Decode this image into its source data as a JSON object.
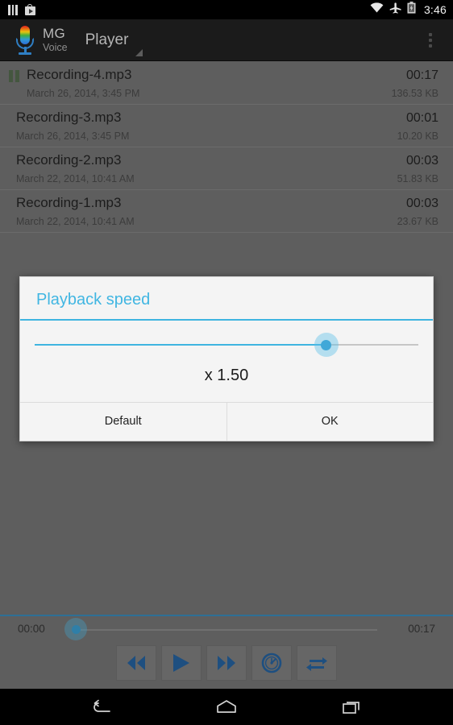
{
  "statusbar": {
    "icons": [
      "bars-icon",
      "play-store-icon",
      "wifi-icon",
      "airplane-mode-icon",
      "battery-icon"
    ],
    "time": "3:46"
  },
  "actionbar": {
    "logo": "mg-voice-microphone-logo",
    "brand_main": "MG",
    "brand_sub": "Voice",
    "spinner_label": "Player",
    "overflow": "overflow-menu-icon"
  },
  "recordings": [
    {
      "name": "Recording-4.mp3",
      "date": "March 26, 2014, 3:45 PM",
      "duration": "00:17",
      "size": "136.53 KB",
      "playing": true
    },
    {
      "name": "Recording-3.mp3",
      "date": "March 26, 2014, 3:45 PM",
      "duration": "00:01",
      "size": "10.20 KB",
      "playing": false
    },
    {
      "name": "Recording-2.mp3",
      "date": "March 22, 2014, 10:41 AM",
      "duration": "00:03",
      "size": "51.83 KB",
      "playing": false
    },
    {
      "name": "Recording-1.mp3",
      "date": "March 22, 2014, 10:41 AM",
      "duration": "00:03",
      "size": "23.67 KB",
      "playing": false
    }
  ],
  "dialog": {
    "title": "Playback speed",
    "value_label": "x 1.50",
    "slider_percent": 76,
    "buttons": {
      "default_label": "Default",
      "ok_label": "OK"
    },
    "accent_color": "#3fb4e0"
  },
  "player": {
    "elapsed": "00:00",
    "total": "00:17",
    "seek_percent": 0,
    "controls": [
      {
        "name": "rewind-button"
      },
      {
        "name": "play-button"
      },
      {
        "name": "fast-forward-button"
      },
      {
        "name": "playback-speed-button"
      },
      {
        "name": "repeat-button"
      }
    ]
  },
  "navbar": {
    "back": "back-icon",
    "home": "home-icon",
    "recents": "recents-icon"
  }
}
